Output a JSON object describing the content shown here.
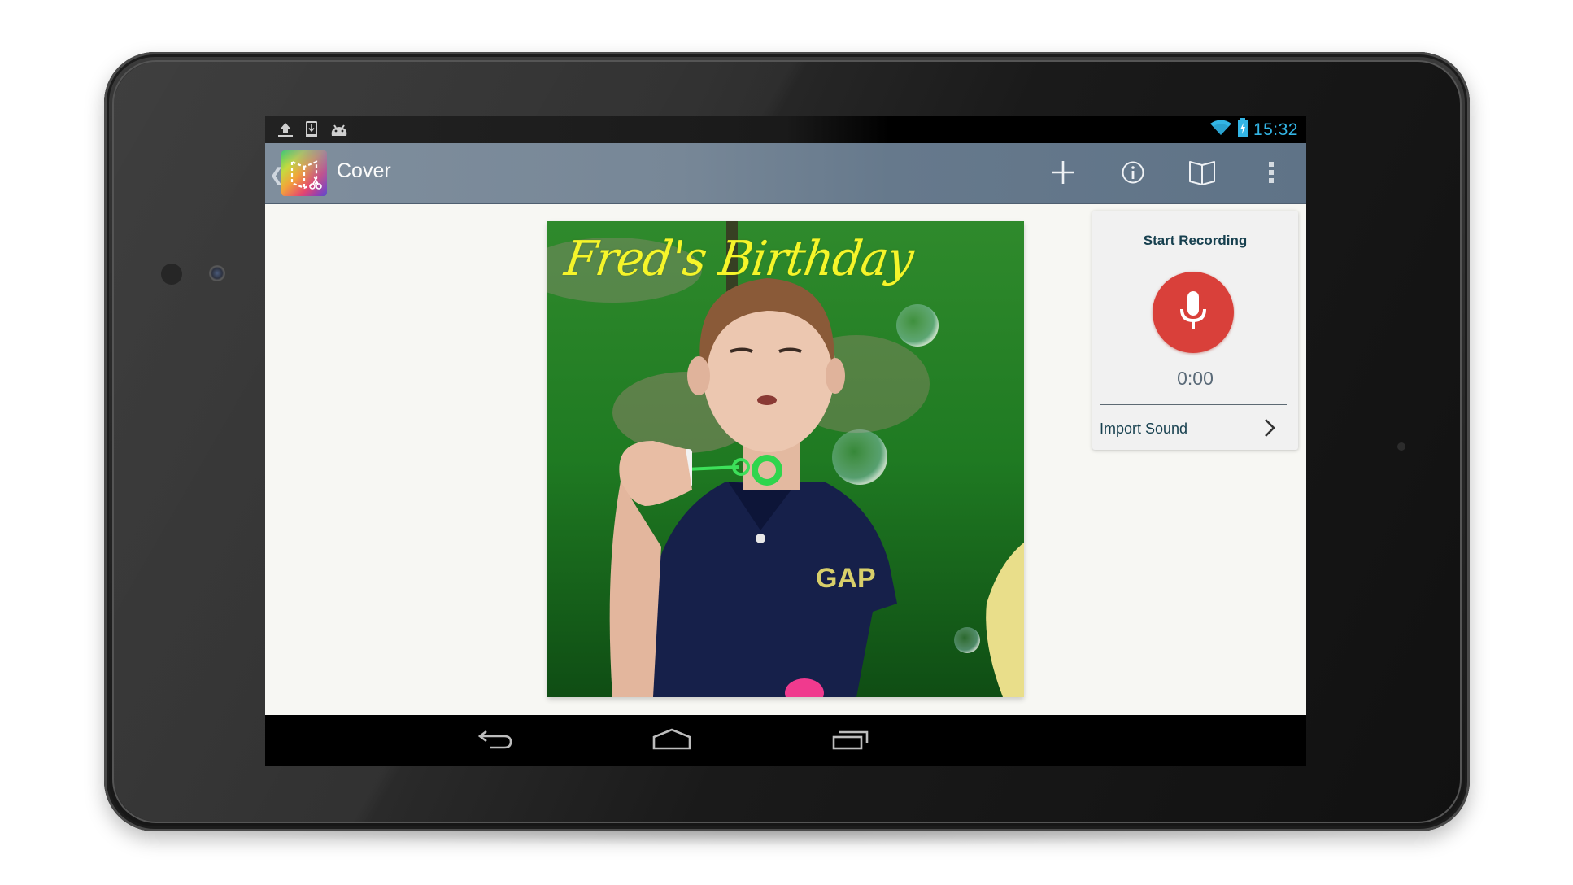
{
  "status_bar": {
    "notification_icons": [
      "upload-icon",
      "download-to-device-icon",
      "android-debug-icon"
    ],
    "system_icons": [
      "wifi-icon",
      "battery-charging-icon"
    ],
    "time": "15:32",
    "accent_color": "#33b5e5"
  },
  "action_bar": {
    "up_icon": "chevron-left-icon",
    "app_icon": "book-creator-icon",
    "title": "Cover",
    "actions": [
      {
        "name": "add",
        "icon": "plus-icon"
      },
      {
        "name": "info",
        "icon": "info-icon"
      },
      {
        "name": "read-book",
        "icon": "open-book-icon"
      },
      {
        "name": "overflow-menu",
        "icon": "more-vertical-icon"
      }
    ],
    "color": "#66798c"
  },
  "page": {
    "image_description": "Boy blowing bubbles on a grassy lawn",
    "title_text": "Fred's Birthday",
    "title_color": "#f5f52a"
  },
  "recording_panel": {
    "title": "Start Recording",
    "mic_icon": "microphone-icon",
    "mic_color": "#d9403a",
    "timer": "0:00",
    "import_label": "Import Sound",
    "import_icon": "chevron-right-icon"
  },
  "nav_bar": {
    "buttons": [
      {
        "name": "back",
        "icon": "back-icon"
      },
      {
        "name": "home",
        "icon": "home-icon"
      },
      {
        "name": "recents",
        "icon": "recent-apps-icon"
      }
    ]
  }
}
